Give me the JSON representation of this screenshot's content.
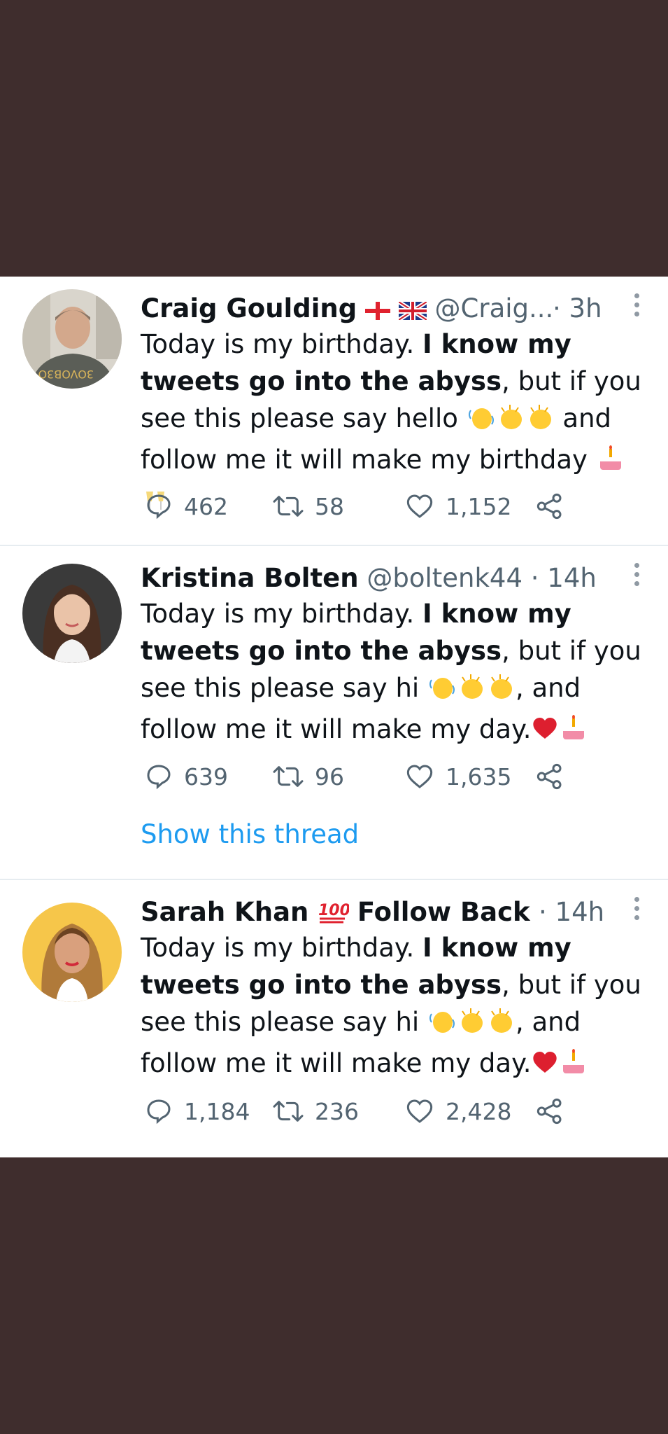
{
  "tweets": [
    {
      "name": "Craig Goulding",
      "handle": "@Craig...",
      "time": "· 3h",
      "text_a": "Today is my birthday. ",
      "text_bold": "I know my tweets go into the abyss",
      "text_b": ", but if you see this please say hello ",
      "text_c": " and follow me it will make my birthday ",
      "replies": "462",
      "retweets": "58",
      "likes": "1,152"
    },
    {
      "name": "Kristina Bolten",
      "handle": "@boltenk44",
      "time": "· 14h",
      "text_a": "Today is my birthday. ",
      "text_bold": "I know my tweets go into the abyss",
      "text_b": ", but if you see this please say hi ",
      "text_c": ", and follow me it will make my day.",
      "replies": "639",
      "retweets": "96",
      "likes": "1,635",
      "show_thread": "Show this thread"
    },
    {
      "name": "Sarah Khan",
      "name_suffix": "Follow Back",
      "time": "· 14h",
      "text_a": "Today is my birthday. ",
      "text_bold": "I know my tweets go into the abyss",
      "text_b": ", but if you see this please say hi ",
      "text_c": ", and follow me it will make my day.",
      "replies": "1,184",
      "retweets": "236",
      "likes": "2,428"
    }
  ],
  "icons": [
    "reply-icon",
    "retweet-icon",
    "like-icon",
    "share-icon",
    "more-options-icon"
  ],
  "colors": {
    "background": "#3f2d2d",
    "card": "#ffffff",
    "link": "#1d9bf0",
    "muted": "#536471"
  }
}
